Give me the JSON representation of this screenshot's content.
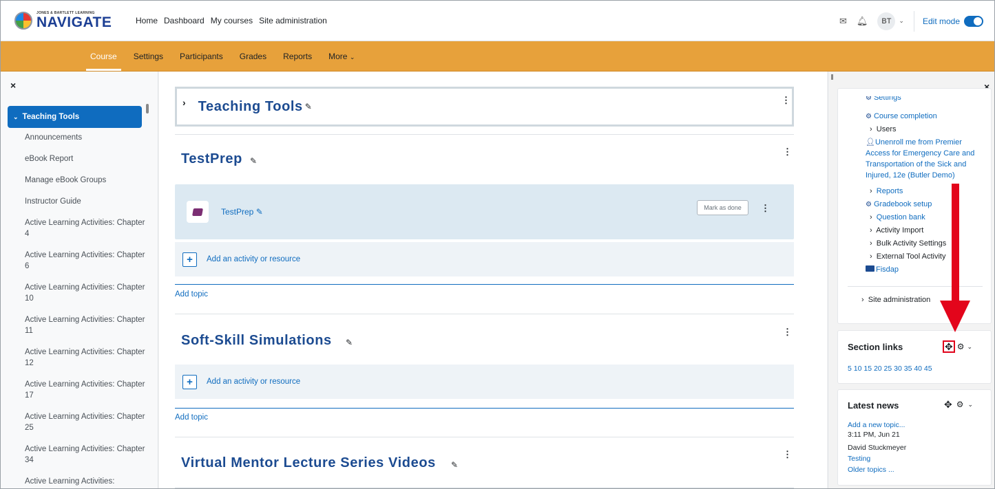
{
  "brand": {
    "small": "JONES & BARTLETT LEARNING",
    "big": "NAVIGATE"
  },
  "primary_nav": [
    "Home",
    "Dashboard",
    "My courses",
    "Site administration"
  ],
  "user": {
    "initials": "BT",
    "edit_mode_label": "Edit mode",
    "edit_mode_on": true
  },
  "secondary_nav": [
    "Course",
    "Settings",
    "Participants",
    "Grades",
    "Reports",
    "More"
  ],
  "left_drawer": {
    "close": "×",
    "active_item": "Teaching Tools",
    "items": [
      "Announcements",
      "eBook Report",
      "Manage eBook Groups",
      "Instructor Guide",
      "Active Learning Activities: Chapter 4",
      "Active Learning Activities: Chapter 6",
      "Active Learning Activities: Chapter 10",
      "Active Learning Activities: Chapter 11",
      "Active Learning Activities: Chapter 12",
      "Active Learning Activities: Chapter 17",
      "Active Learning Activities: Chapter 25",
      "Active Learning Activities: Chapter 34",
      "Active Learning Activities:"
    ]
  },
  "main": {
    "sections": [
      {
        "title": "Teaching Tools"
      },
      {
        "title": "TestPrep"
      },
      {
        "title": "Soft-Skill Simulations"
      },
      {
        "title": "Virtual Mentor Lecture Series Videos"
      }
    ],
    "activity": {
      "name": "TestPrep",
      "mark_done": "Mark as done"
    },
    "add_activity": "Add an activity or resource",
    "add_topic": "Add topic"
  },
  "right_drawer": {
    "close": "×",
    "nav_items": [
      "Settings",
      "Course completion",
      "Users",
      "Unenroll me from Premier",
      "Access for Emergency Care and",
      "Transportation of the Sick and",
      "Injured, 12e (Butler Demo)",
      "Reports",
      "Gradebook setup",
      "Question bank",
      "Activity Import",
      "Bulk Activity Settings",
      "External Tool Activity",
      "Fisdap",
      "Site administration"
    ],
    "section_links": {
      "title": "Section links",
      "links": "5 10 15 20 25 30 35 40 45"
    },
    "latest_news": {
      "title": "Latest news",
      "add": "Add a new topic...",
      "time": "3:11 PM, Jun 21",
      "author": "David Stuckmeyer",
      "topic": "Testing",
      "older": "Older topics ..."
    }
  },
  "colors": {
    "accent": "#0f6cbf",
    "secondary_nav_bg": "#e7a13b",
    "annotation_arrow": "#e3051b"
  }
}
